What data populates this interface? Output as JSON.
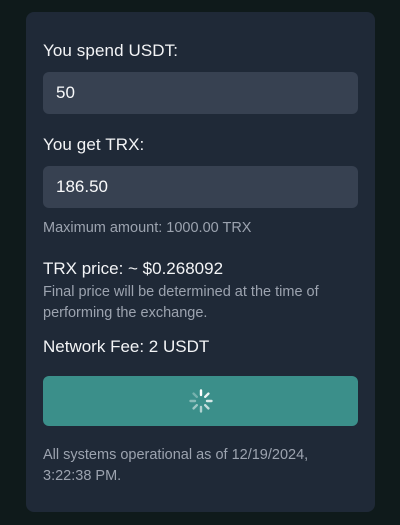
{
  "spend": {
    "label": "You spend USDT:",
    "value": "50"
  },
  "get": {
    "label": "You get TRX:",
    "value": "186.50",
    "max_note": "Maximum amount: 1000.00 TRX"
  },
  "price": {
    "label": "TRX price: ~ $0.268092",
    "note": "Final price will be determined at the time of performing the exchange."
  },
  "fee": {
    "label": "Network Fee: 2 USDT"
  },
  "submit": {
    "state": "loading",
    "icon": "spinner-icon"
  },
  "status": {
    "text": "All systems operational as of 12/19/2024, 3:22:38 PM."
  },
  "colors": {
    "background": "#0f1a1b",
    "card": "#1f2937",
    "field": "#374151",
    "accent": "#3b8f8a",
    "muted_text": "#9ca3af"
  }
}
